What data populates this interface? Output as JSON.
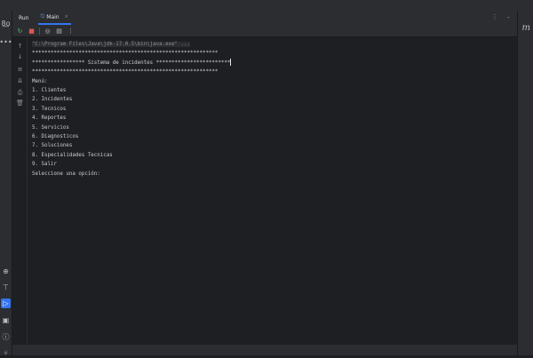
{
  "tool_window": {
    "run_label": "Run",
    "tab_label": "Main",
    "tab_close": "×"
  },
  "console": {
    "command_line": "\"C:\\Program Files\\Java\\jdk-17.0.5\\bin\\java.exe\" ...",
    "separator_top": "************************************************************",
    "banner": "***************** Sistema de incidentes ************************",
    "separator_bottom": "************************************************************",
    "menu_title": "Menú:",
    "menu_items": [
      "1. Clientes",
      "2. Incidentes",
      "3. Tecnicos",
      "4. Reportes",
      "5. Servicios",
      "6. Diagnosticos",
      "7. Soluciones",
      "8. Especialidades Tecnicas",
      "9. Salir"
    ],
    "prompt": "Seleccione una opción:"
  },
  "icons": {
    "left_rail": [
      "project-icon",
      "more-icon",
      "services-icon",
      "terminal-icon",
      "run-icon",
      "problems-icon",
      "info-icon"
    ],
    "run_toolbar": [
      "rerun-icon",
      "stop-icon",
      "camera-icon",
      "layout-icon",
      "more-icon"
    ],
    "side_toolbar": [
      "scroll-up-icon",
      "scroll-down-icon",
      "soft-wrap-icon",
      "scroll-end-icon",
      "print-icon",
      "trash-icon"
    ]
  },
  "colors": {
    "accent": "#3574f0",
    "background": "#1e1f22",
    "panel": "#2b2d30",
    "rerun": "#5fb865",
    "stop": "#e05555"
  }
}
